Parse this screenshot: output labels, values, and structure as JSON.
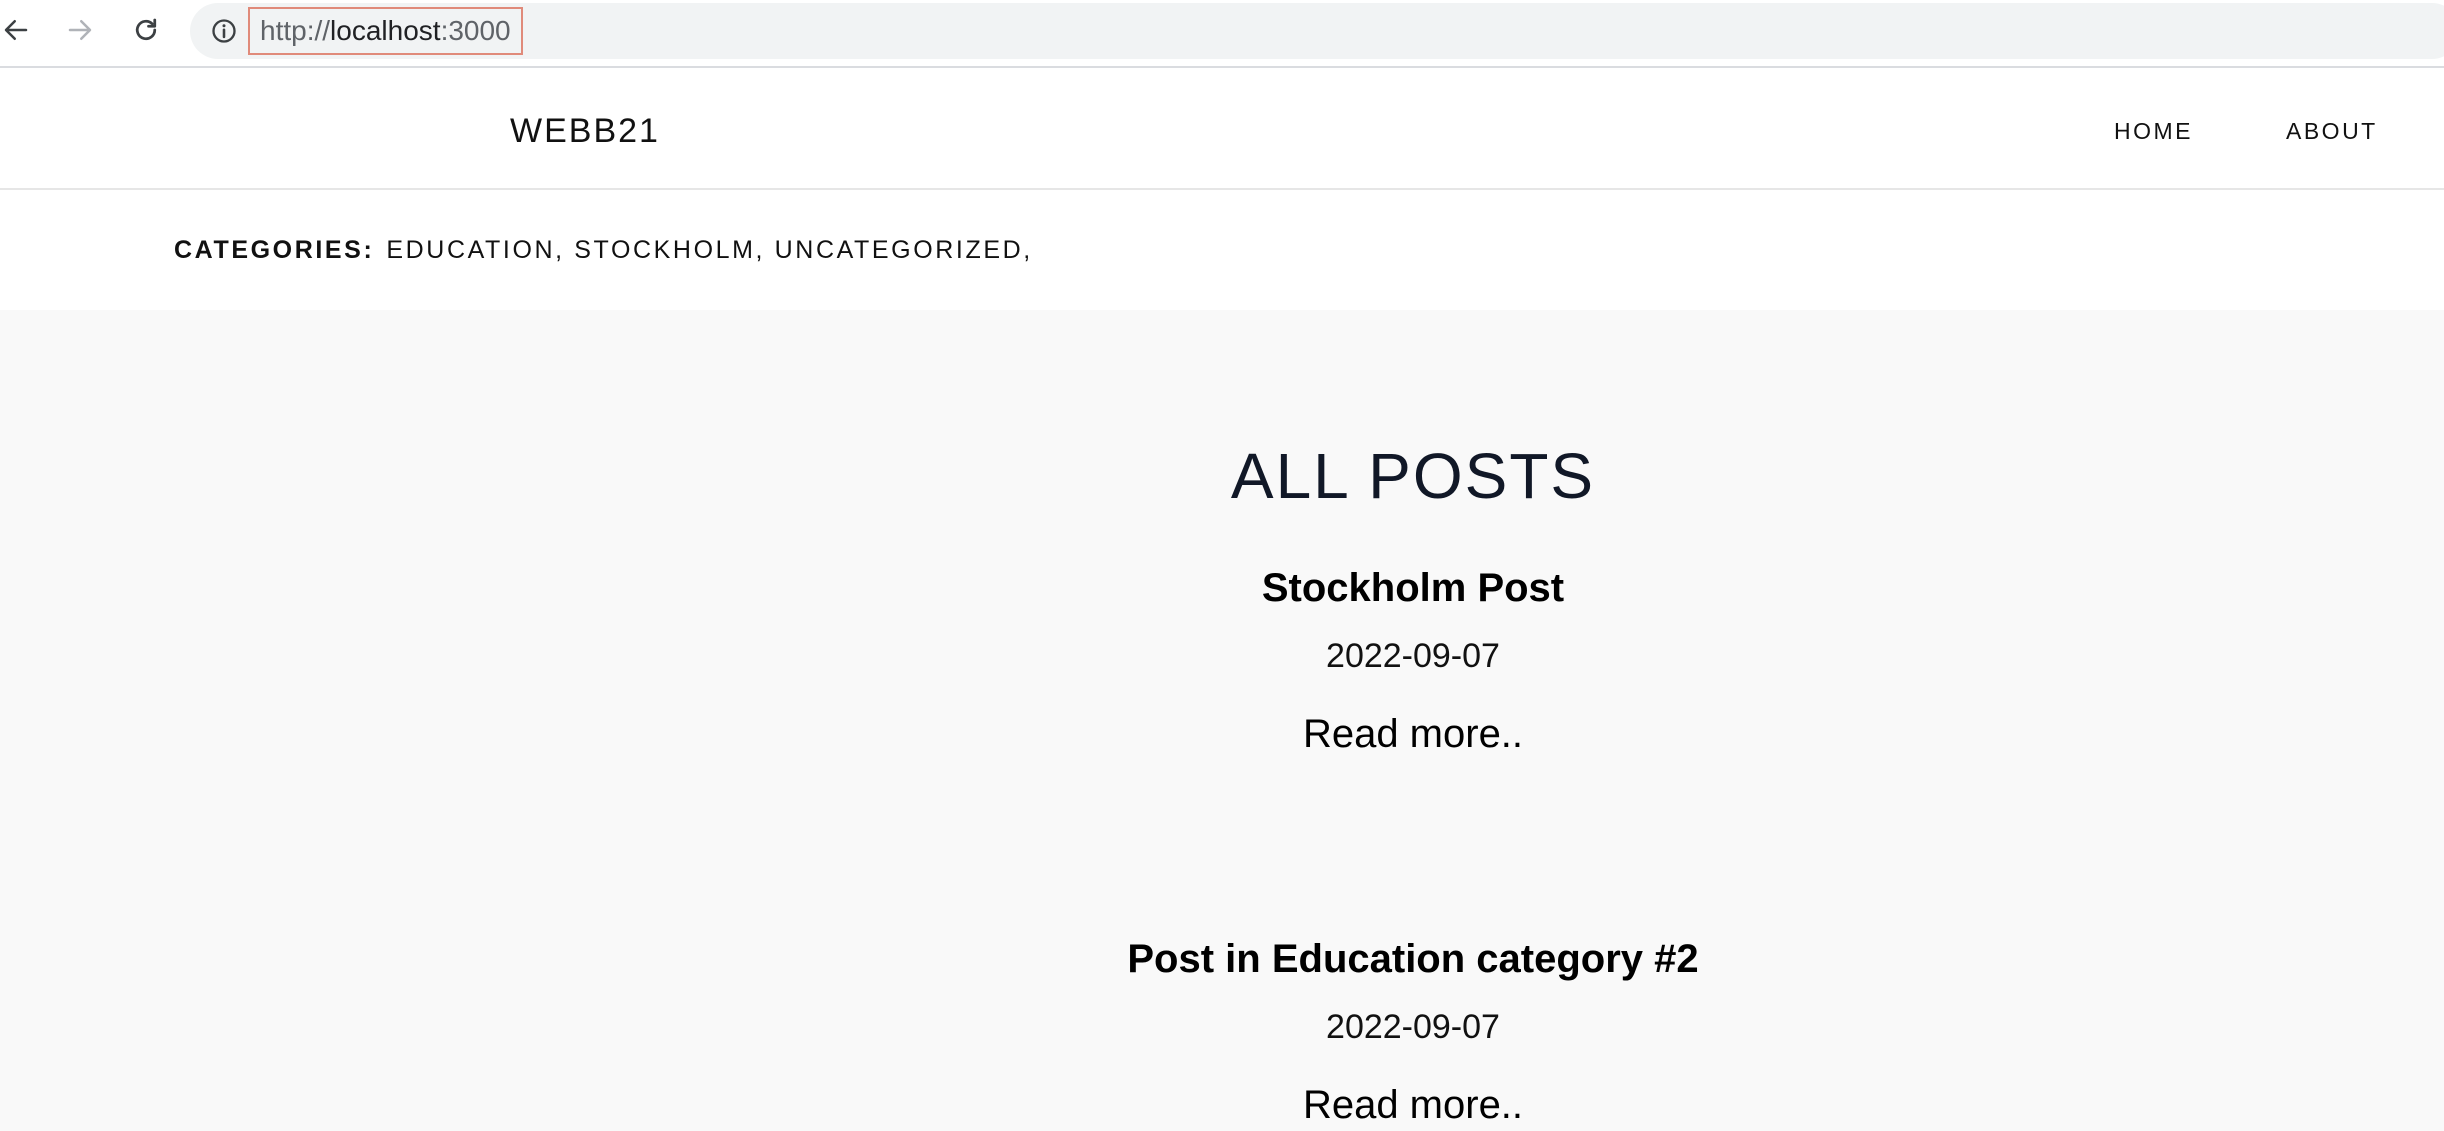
{
  "browser": {
    "url_prefix": "http://",
    "url_host": "localhost",
    "url_port": ":3000"
  },
  "header": {
    "logo": "WEBB21",
    "nav": [
      {
        "label": "HOME"
      },
      {
        "label": "ABOUT"
      }
    ]
  },
  "categories": {
    "label": "CATEGORIES:",
    "items": [
      "EDUCATION,",
      "STOCKHOLM,",
      "UNCATEGORIZED,"
    ]
  },
  "main": {
    "title": "ALL POSTS",
    "posts": [
      {
        "title": "Stockholm Post",
        "date": "2022-09-07",
        "more": "Read more.."
      },
      {
        "title": "Post in Education category #2",
        "date": "2022-09-07",
        "more": "Read more.."
      }
    ]
  }
}
